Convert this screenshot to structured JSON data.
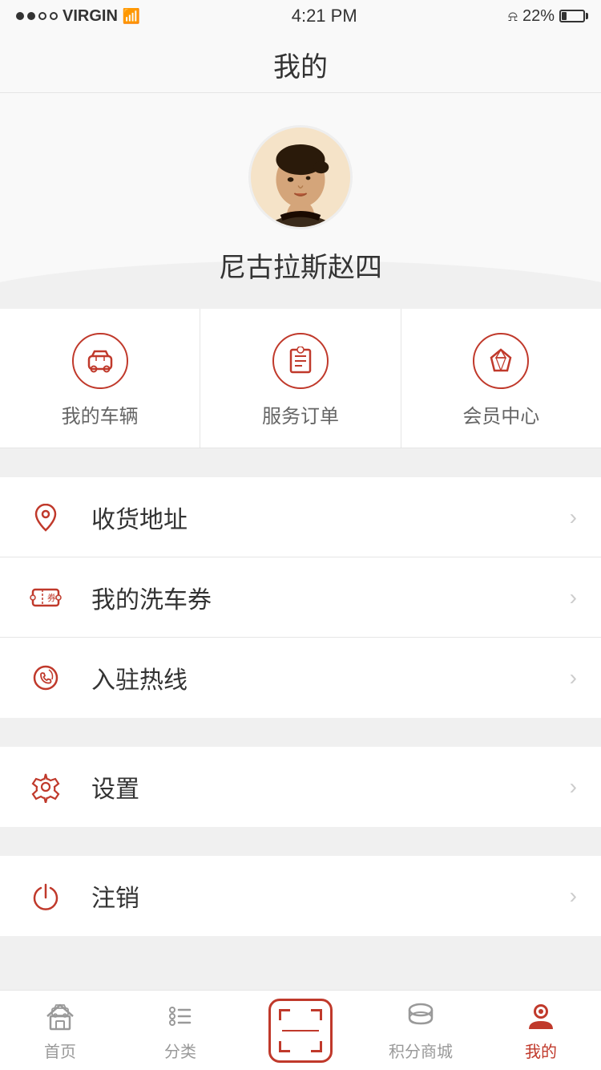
{
  "statusBar": {
    "carrier": "VIRGIN",
    "time": "4:21 PM",
    "battery": "22%"
  },
  "header": {
    "title": "我的"
  },
  "profile": {
    "name": "尼古拉斯赵四"
  },
  "quickActions": [
    {
      "id": "my-vehicle",
      "label": "我的车辆",
      "icon": "car"
    },
    {
      "id": "service-order",
      "label": "服务订单",
      "icon": "order"
    },
    {
      "id": "member-center",
      "label": "会员中心",
      "icon": "diamond"
    }
  ],
  "menuGroups": [
    {
      "items": [
        {
          "id": "address",
          "label": "收货地址",
          "icon": "location"
        },
        {
          "id": "car-wash-coupon",
          "label": "我的洗车券",
          "icon": "coupon"
        },
        {
          "id": "hotline",
          "label": "入驻热线",
          "icon": "phone"
        }
      ]
    },
    {
      "items": [
        {
          "id": "settings",
          "label": "设置",
          "icon": "settings"
        }
      ]
    },
    {
      "items": [
        {
          "id": "logout",
          "label": "注销",
          "icon": "power"
        }
      ]
    }
  ],
  "tabBar": {
    "items": [
      {
        "id": "home",
        "label": "首页",
        "icon": "home",
        "active": false
      },
      {
        "id": "category",
        "label": "分类",
        "icon": "category",
        "active": false
      },
      {
        "id": "scanner",
        "label": "",
        "icon": "scanner",
        "active": false
      },
      {
        "id": "points-mall",
        "label": "积分商城",
        "icon": "points",
        "active": false
      },
      {
        "id": "mine",
        "label": "我的",
        "icon": "mine",
        "active": true
      }
    ]
  }
}
